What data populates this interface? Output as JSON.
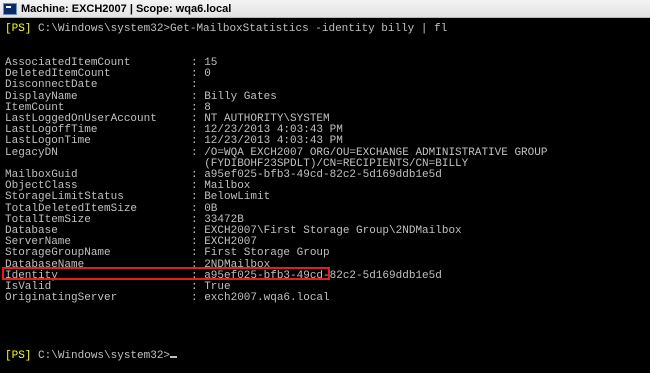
{
  "window": {
    "title": "Machine: EXCH2007 | Scope: wqa6.local"
  },
  "console": {
    "prompt_tag": "[PS]",
    "prompt_path": "C:\\Windows\\system32>",
    "command": "Get-MailboxStatistics -identity billy | fl",
    "properties": [
      {
        "name": "AssociatedItemCount",
        "value": "15"
      },
      {
        "name": "DeletedItemCount",
        "value": "0"
      },
      {
        "name": "DisconnectDate",
        "value": ""
      },
      {
        "name": "DisplayName",
        "value": "Billy Gates"
      },
      {
        "name": "ItemCount",
        "value": "8"
      },
      {
        "name": "LastLoggedOnUserAccount",
        "value": "NT AUTHORITY\\SYSTEM"
      },
      {
        "name": "LastLogoffTime",
        "value": "12/23/2013 4:03:43 PM"
      },
      {
        "name": "LastLogonTime",
        "value": "12/23/2013 4:03:43 PM"
      },
      {
        "name": "LegacyDN",
        "value": "/O=WQA EXCH2007 ORG/OU=EXCHANGE ADMINISTRATIVE GROUP",
        "continuation": "(FYDIBOHF23SPDLT)/CN=RECIPIENTS/CN=BILLY"
      },
      {
        "name": "MailboxGuid",
        "value": "a95ef025-bfb3-49cd-82c2-5d169ddb1e5d"
      },
      {
        "name": "ObjectClass",
        "value": "Mailbox"
      },
      {
        "name": "StorageLimitStatus",
        "value": "BelowLimit"
      },
      {
        "name": "TotalDeletedItemSize",
        "value": "0B"
      },
      {
        "name": "TotalItemSize",
        "value": "33472B"
      },
      {
        "name": "Database",
        "value": "EXCH2007\\First Storage Group\\2NDMailbox"
      },
      {
        "name": "ServerName",
        "value": "EXCH2007"
      },
      {
        "name": "StorageGroupName",
        "value": "First Storage Group"
      },
      {
        "name": "DatabaseName",
        "value": "2NDMailbox"
      },
      {
        "name": "Identity",
        "value": "a95ef025-bfb3-49cd-82c2-5d169ddb1e5d"
      },
      {
        "name": "IsValid",
        "value": "True"
      },
      {
        "name": "OriginatingServer",
        "value": "exch2007.wqa6.local"
      }
    ],
    "highlighted_property": "DatabaseName",
    "highlight_color": "#e0201b",
    "prompt_tag_color": "#ffff00",
    "text_color": "#c0c0c0",
    "background_color": "#000000"
  }
}
